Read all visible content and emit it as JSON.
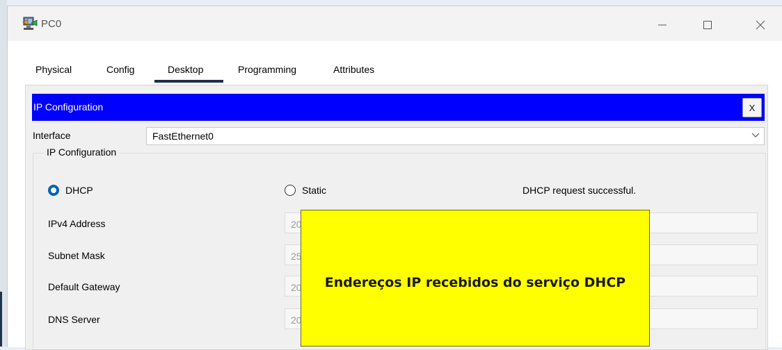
{
  "window": {
    "title": "PC0",
    "controls": {
      "minimize": "—",
      "maximize": "☐",
      "close": "✕"
    }
  },
  "tabs": [
    {
      "label": "Physical"
    },
    {
      "label": "Config"
    },
    {
      "label": "Desktop",
      "active": true
    },
    {
      "label": "Programming"
    },
    {
      "label": "Attributes"
    }
  ],
  "ipconfig": {
    "title": "IP Configuration",
    "close_label": "X",
    "interface_label": "Interface",
    "interface_value": "FastEthernet0",
    "group_title": "IP Configuration",
    "dhcp_label": "DHCP",
    "dhcp_selected": true,
    "static_label": "Static",
    "status_text": "DHCP request successful.",
    "rows": [
      {
        "label": "IPv4 Address",
        "value": "20"
      },
      {
        "label": "Subnet Mask",
        "value": "25"
      },
      {
        "label": "Default Gateway",
        "value": "20"
      },
      {
        "label": "DNS Server",
        "value": "20"
      }
    ]
  },
  "annotation": {
    "text": "Endereços IP recebidos do serviço DHCP"
  },
  "colors": {
    "ip_bar": "#0000ff",
    "note_bg": "#ffff00",
    "radio_accent": "#0063b1",
    "tab_underline": "#1e2d4a"
  }
}
